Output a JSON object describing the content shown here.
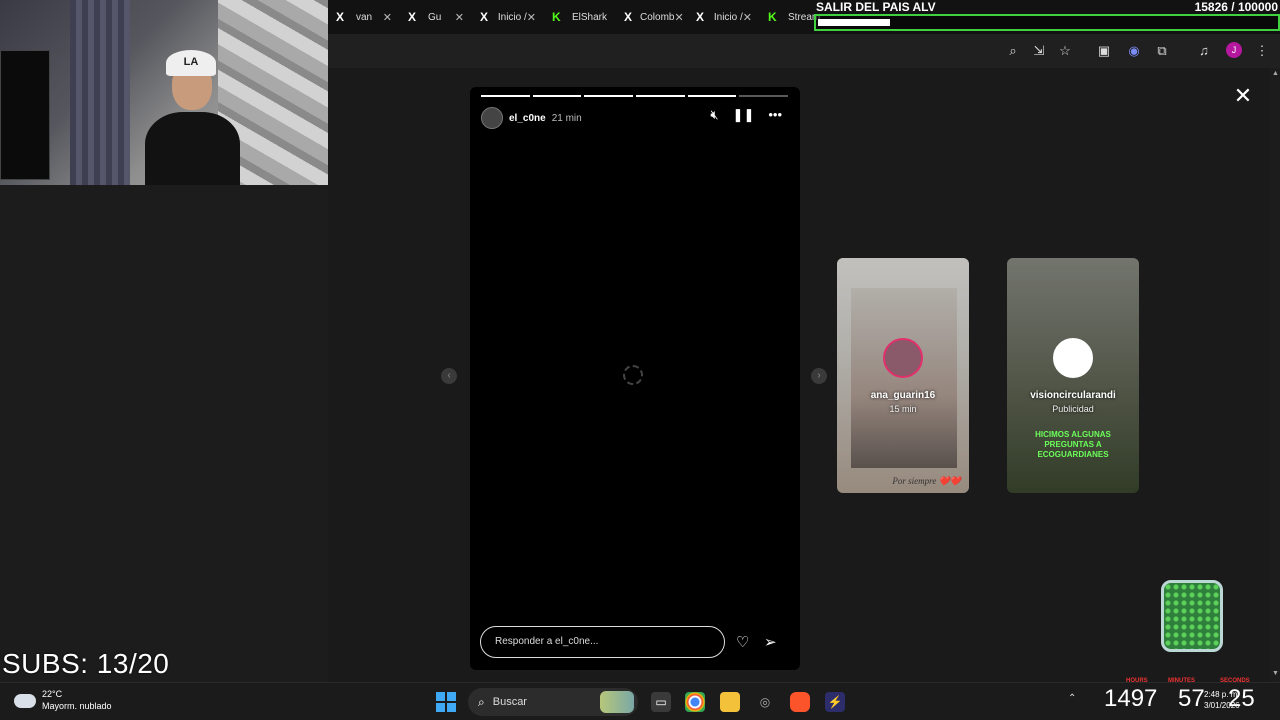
{
  "tabs": [
    {
      "icon": "X",
      "label": "van",
      "kind": "x"
    },
    {
      "icon": "X",
      "label": "Gu",
      "kind": "x"
    },
    {
      "icon": "X",
      "label": "Inicio /",
      "kind": "x"
    },
    {
      "icon": "K",
      "label": "ElShark",
      "kind": "kick"
    },
    {
      "icon": "X",
      "label": "Colomb",
      "kind": "x"
    },
    {
      "icon": "X",
      "label": "Inicio /",
      "kind": "x"
    },
    {
      "icon": "K",
      "label": "Stream",
      "kind": "kick"
    }
  ],
  "tab_close_glyph": "✕",
  "goal": {
    "title": "SALIR DEL PAIS ALV",
    "count": "15826 / 100000",
    "progress": 0.158
  },
  "toolbar_icons": [
    "zoom-icon",
    "install-icon",
    "bookmark-star-icon",
    "screenshot-icon",
    "extension-blue-icon",
    "puzzle-icon",
    "media-icon",
    "profile-icon",
    "menu-icon"
  ],
  "profile_initial": "J",
  "story": {
    "user": "el_c0ne",
    "time": "21 min",
    "segments_total": 6,
    "segments_done": 5,
    "reply_placeholder": "Responder a el_c0ne..."
  },
  "previews": [
    {
      "user": "ana_guarin16",
      "sub": "15 min",
      "caption": "Por siempre ❤️❤️"
    },
    {
      "user": "visioncircularandi",
      "sub": "Publicidad",
      "ad_text": "HICIMOS ALGUNAS PREGUNTAS A ECOGUARDIANES"
    }
  ],
  "subs": "SUBS: 13/20",
  "taskbar": {
    "weather_temp": "22°C",
    "weather_cond": "Mayorm. nublado",
    "search_label": "Buscar",
    "clock_time": "2:48 p. m.",
    "clock_date": "3/01/2026",
    "big_numbers": [
      "1497",
      "57",
      "25"
    ],
    "timer_labels": [
      "HOURS",
      "MINUTES",
      "SECONDS"
    ]
  }
}
